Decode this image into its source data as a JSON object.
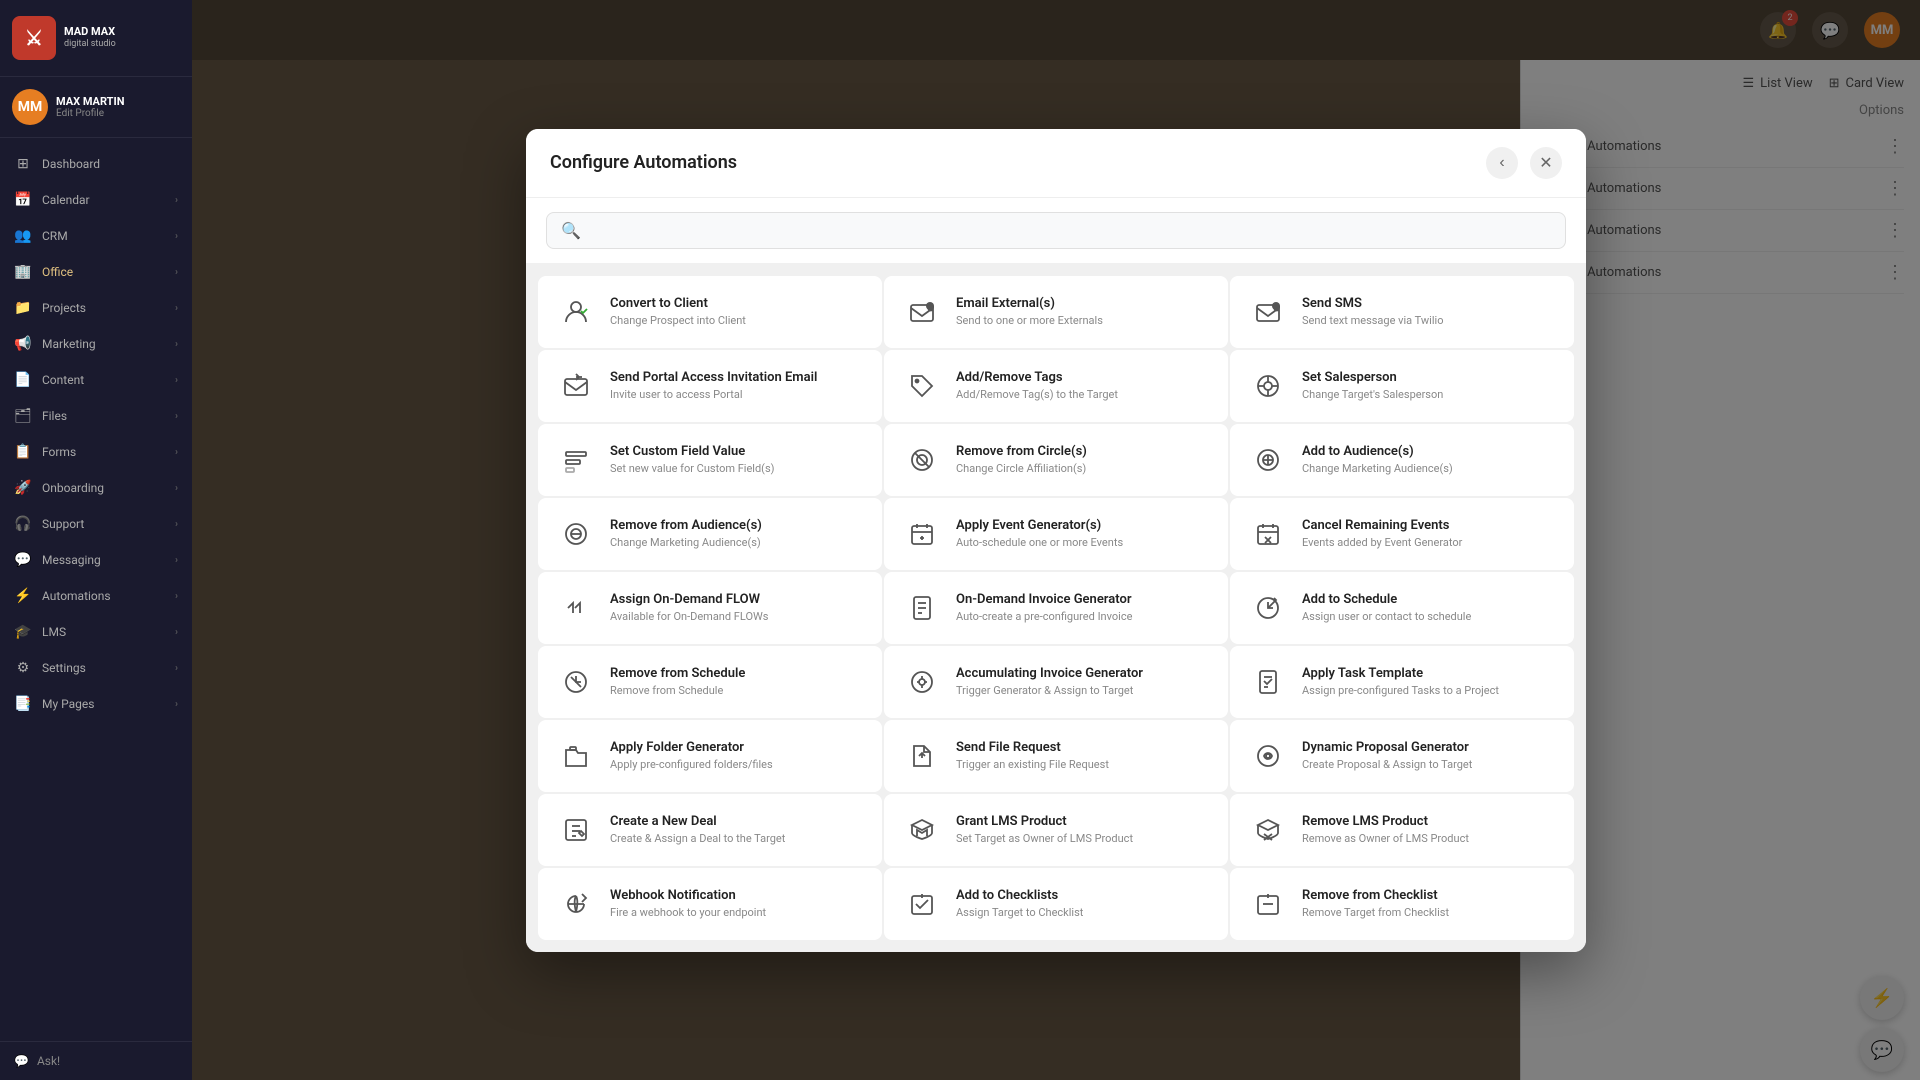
{
  "app": {
    "name": "MAD MAX",
    "tagline": "digital studio"
  },
  "user": {
    "name": "MAX MARTIN",
    "edit_label": "Edit Profile"
  },
  "sidebar": {
    "items": [
      {
        "id": "dashboard",
        "label": "Dashboard",
        "icon": "⊞",
        "has_arrow": false
      },
      {
        "id": "calendar",
        "label": "Calendar",
        "icon": "📅",
        "has_arrow": true
      },
      {
        "id": "crm",
        "label": "CRM",
        "icon": "👥",
        "has_arrow": true
      },
      {
        "id": "office",
        "label": "Office",
        "icon": "🏢",
        "has_arrow": true,
        "highlight": true
      },
      {
        "id": "projects",
        "label": "Projects",
        "icon": "📁",
        "has_arrow": true
      },
      {
        "id": "marketing",
        "label": "Marketing",
        "icon": "📢",
        "has_arrow": true
      },
      {
        "id": "content",
        "label": "Content",
        "icon": "📄",
        "has_arrow": true
      },
      {
        "id": "files",
        "label": "Files",
        "icon": "🗂",
        "has_arrow": true
      },
      {
        "id": "forms",
        "label": "Forms",
        "icon": "📋",
        "has_arrow": true
      },
      {
        "id": "onboarding",
        "label": "Onboarding",
        "icon": "🚀",
        "has_arrow": true
      },
      {
        "id": "support",
        "label": "Support",
        "icon": "🎧",
        "has_arrow": true
      },
      {
        "id": "messaging",
        "label": "Messaging",
        "icon": "💬",
        "has_arrow": true
      },
      {
        "id": "automations",
        "label": "Automations",
        "icon": "⚡",
        "has_arrow": true
      },
      {
        "id": "lms",
        "label": "LMS",
        "icon": "🎓",
        "has_arrow": true
      },
      {
        "id": "settings",
        "label": "Settings",
        "icon": "⚙",
        "has_arrow": true
      },
      {
        "id": "my-pages",
        "label": "My Pages",
        "icon": "📑",
        "has_arrow": true
      }
    ],
    "ask_label": "Ask!"
  },
  "modal": {
    "title": "Configure Automations",
    "search_placeholder": "",
    "automations": [
      {
        "id": "convert-to-client",
        "name": "Convert to Client",
        "desc": "Change Prospect into Client",
        "icon": "👤"
      },
      {
        "id": "email-externals",
        "name": "Email External(s)",
        "desc": "Send to one or more Externals",
        "icon": "@"
      },
      {
        "id": "send-sms",
        "name": "Send SMS",
        "desc": "Send text message via Twilio",
        "icon": "@"
      },
      {
        "id": "send-portal-access",
        "name": "Send Portal Access Invitation Email",
        "desc": "Invite user to access Portal",
        "icon": "✉"
      },
      {
        "id": "add-remove-tags",
        "name": "Add/Remove Tags",
        "desc": "Add/Remove Tag(s) to the Target",
        "icon": "🏷"
      },
      {
        "id": "set-salesperson",
        "name": "Set Salesperson",
        "desc": "Change Target's Salesperson",
        "icon": "◎"
      },
      {
        "id": "set-custom-field",
        "name": "Set Custom Field Value",
        "desc": "Set new value for Custom Field(s)",
        "icon": "⊟"
      },
      {
        "id": "remove-from-circle",
        "name": "Remove from Circle(s)",
        "desc": "Change Circle Affiliation(s)",
        "icon": "◯"
      },
      {
        "id": "add-to-audiences",
        "name": "Add to Audience(s)",
        "desc": "Change Marketing Audience(s)",
        "icon": "◎"
      },
      {
        "id": "remove-from-audiences",
        "name": "Remove from Audience(s)",
        "desc": "Change Marketing Audience(s)",
        "icon": "◎"
      },
      {
        "id": "apply-event-generator",
        "name": "Apply Event Generator(s)",
        "desc": "Auto-schedule one or more Events",
        "icon": "📅"
      },
      {
        "id": "cancel-remaining-events",
        "name": "Cancel Remaining Events",
        "desc": "Events added by Event Generator",
        "icon": "📅"
      },
      {
        "id": "assign-on-demand-flow",
        "name": "Assign On-Demand FLOW",
        "desc": "Available for On-Demand FLOWs",
        "icon": "»"
      },
      {
        "id": "on-demand-invoice",
        "name": "On-Demand Invoice Generator",
        "desc": "Auto-create a pre-configured Invoice",
        "icon": "🧾"
      },
      {
        "id": "add-to-schedule",
        "name": "Add to Schedule",
        "desc": "Assign user or contact to schedule",
        "icon": "🕐"
      },
      {
        "id": "remove-from-schedule",
        "name": "Remove from Schedule",
        "desc": "Remove from Schedule",
        "icon": "🕐"
      },
      {
        "id": "accumulating-invoice",
        "name": "Accumulating Invoice Generator",
        "desc": "Trigger Generator & Assign to Target",
        "icon": "⚙"
      },
      {
        "id": "apply-task-template",
        "name": "Apply Task Template",
        "desc": "Assign pre-configured Tasks to a Project",
        "icon": "✔"
      },
      {
        "id": "apply-folder-generator",
        "name": "Apply Folder Generator",
        "desc": "Apply pre-configured folders/files",
        "icon": "📁"
      },
      {
        "id": "send-file-request",
        "name": "Send File Request",
        "desc": "Trigger an existing File Request",
        "icon": "📎"
      },
      {
        "id": "dynamic-proposal",
        "name": "Dynamic Proposal Generator",
        "desc": "Create Proposal & Assign to Target",
        "icon": "⚙"
      },
      {
        "id": "create-new-deal",
        "name": "Create a New Deal",
        "desc": "Create & Assign a Deal to the Target",
        "icon": "📝"
      },
      {
        "id": "grant-lms-product",
        "name": "Grant LMS Product",
        "desc": "Set Target as Owner of LMS Product",
        "icon": "🎓"
      },
      {
        "id": "remove-lms-product",
        "name": "Remove LMS Product",
        "desc": "Remove as Owner of LMS Product",
        "icon": "🎓"
      },
      {
        "id": "webhook-notification",
        "name": "Webhook Notification",
        "desc": "Fire a webhook to your endpoint",
        "icon": "🔗"
      },
      {
        "id": "add-to-checklists",
        "name": "Add to Checklists",
        "desc": "Assign Target to Checklist",
        "icon": "✔"
      },
      {
        "id": "remove-from-checklist",
        "name": "Remove from Checklist",
        "desc": "Remove Target from Checklist",
        "icon": "✔"
      }
    ]
  },
  "right_panel": {
    "view_list": "List View",
    "view_card": "Card View",
    "options": "Options",
    "manage_automations": "Manage Automations"
  }
}
